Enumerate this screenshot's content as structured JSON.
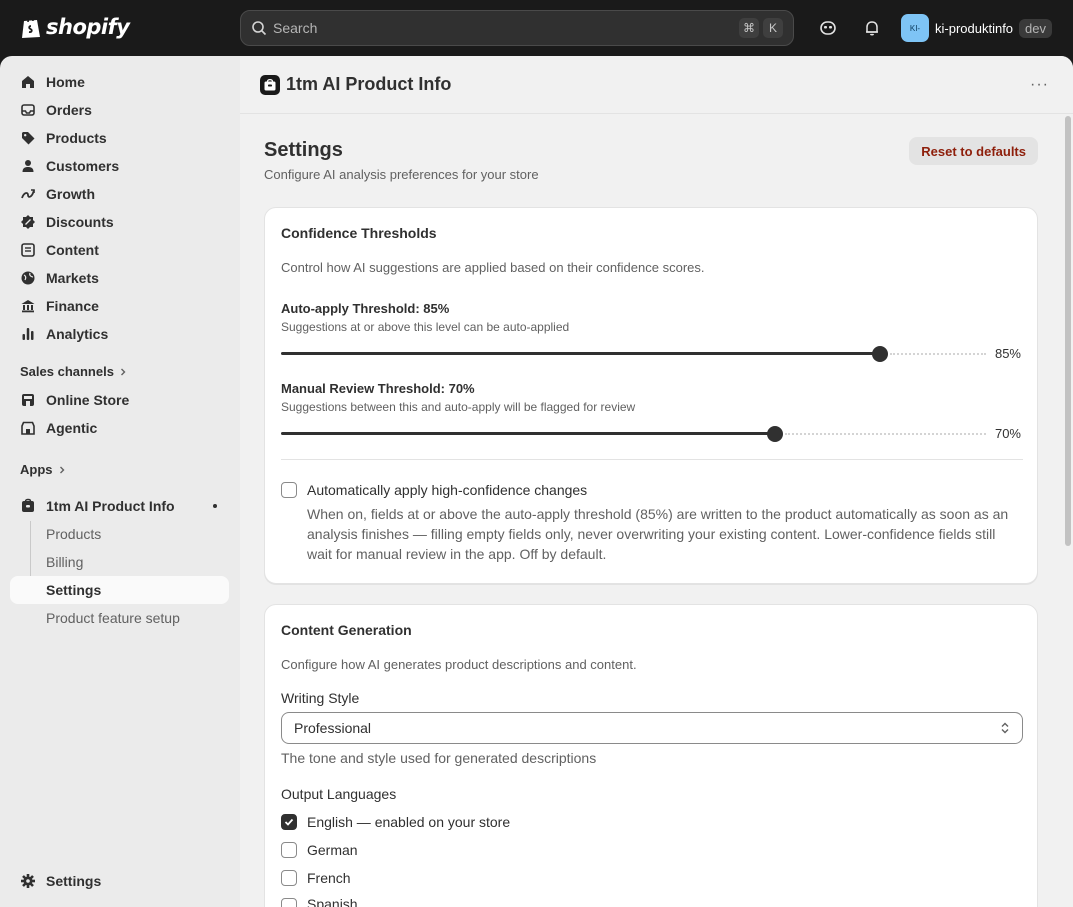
{
  "topbar": {
    "brand": "shopify",
    "search_placeholder": "Search",
    "shortcut_cmd": "⌘",
    "shortcut_key": "K",
    "store_initials": "KI-",
    "store_name": "ki-produktinfo",
    "store_badge": "dev"
  },
  "sidebar": {
    "items": [
      {
        "label": "Home",
        "icon": "home-icon"
      },
      {
        "label": "Orders",
        "icon": "inbox-icon"
      },
      {
        "label": "Products",
        "icon": "tag-icon"
      },
      {
        "label": "Customers",
        "icon": "person-icon"
      },
      {
        "label": "Growth",
        "icon": "growth-icon"
      },
      {
        "label": "Discounts",
        "icon": "discount-icon"
      },
      {
        "label": "Content",
        "icon": "content-icon"
      },
      {
        "label": "Markets",
        "icon": "globe-icon"
      },
      {
        "label": "Finance",
        "icon": "bank-icon"
      },
      {
        "label": "Analytics",
        "icon": "bar-chart-icon"
      }
    ],
    "sales_channels_label": "Sales channels",
    "channels": [
      {
        "label": "Online Store",
        "icon": "store-icon"
      },
      {
        "label": "Agentic",
        "icon": "agentic-icon"
      }
    ],
    "apps_label": "Apps",
    "app_name": "1tm AI Product Info",
    "app_subitems": [
      "Products",
      "Billing",
      "Settings",
      "Product feature setup"
    ],
    "active_subitem": "Settings",
    "settings_label": "Settings"
  },
  "main": {
    "app_title": "1tm AI Product Info",
    "more_label": "···",
    "page_title": "Settings",
    "page_subtitle": "Configure AI analysis preferences for your store",
    "reset_label": "Reset to defaults",
    "confidence": {
      "title": "Confidence Thresholds",
      "description": "Control how AI suggestions are applied based on their confidence scores.",
      "auto_apply": {
        "label": "Auto-apply Threshold: 85%",
        "help": "Suggestions at or above this level can be auto-applied",
        "value": 85,
        "value_label": "85%"
      },
      "manual_review": {
        "label": "Manual Review Threshold: 70%",
        "help": "Suggestions between this and auto-apply will be flagged for review",
        "value": 70,
        "value_label": "70%"
      },
      "auto_apply_checkbox": {
        "label": "Automatically apply high-confidence changes",
        "checked": false,
        "help": "When on, fields at or above the auto-apply threshold (85%) are written to the product automatically as soon as an analysis finishes — filling empty fields only, never overwriting your existing content. Lower-confidence fields still wait for manual review in the app. Off by default."
      }
    },
    "content": {
      "title": "Content Generation",
      "description": "Configure how AI generates product descriptions and content.",
      "writing_style_label": "Writing Style",
      "writing_style_value": "Professional",
      "writing_style_help": "The tone and style used for generated descriptions",
      "output_languages_label": "Output Languages",
      "languages": [
        {
          "label": "English — enabled on your store",
          "checked": true
        },
        {
          "label": "German",
          "checked": false
        },
        {
          "label": "French",
          "checked": false
        },
        {
          "label": "Spanish",
          "checked": false
        }
      ]
    }
  }
}
